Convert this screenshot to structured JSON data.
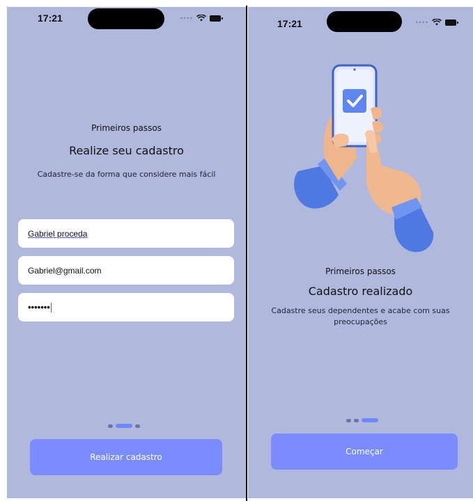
{
  "left": {
    "status": {
      "time": "17:21"
    },
    "kicker": "Primeiros passos",
    "title": "Realize seu cadastro",
    "subtitle": "Cadastre-se da forma que considere mais fácil",
    "fields": {
      "name": "Gabriel proceda",
      "email": "Gabriel@gmail.com",
      "password": "•••••••"
    },
    "pager": {
      "total": 3,
      "active": 1
    },
    "cta": "Realizar cadastro"
  },
  "right": {
    "status": {
      "time": "17:21"
    },
    "illustration": "hand-holding-phone-checkmark",
    "kicker": "Primeiros passos",
    "title": "Cadastro realizado",
    "subtitle": "Cadastre seus dependentes e acabe com suas preocupações",
    "pager": {
      "total": 3,
      "active": 2
    },
    "cta": "Começar"
  },
  "colors": {
    "background": "#b0b8dd",
    "button": "#7a8cff",
    "pager_active": "#6f87ff",
    "field": "#ffffff"
  }
}
